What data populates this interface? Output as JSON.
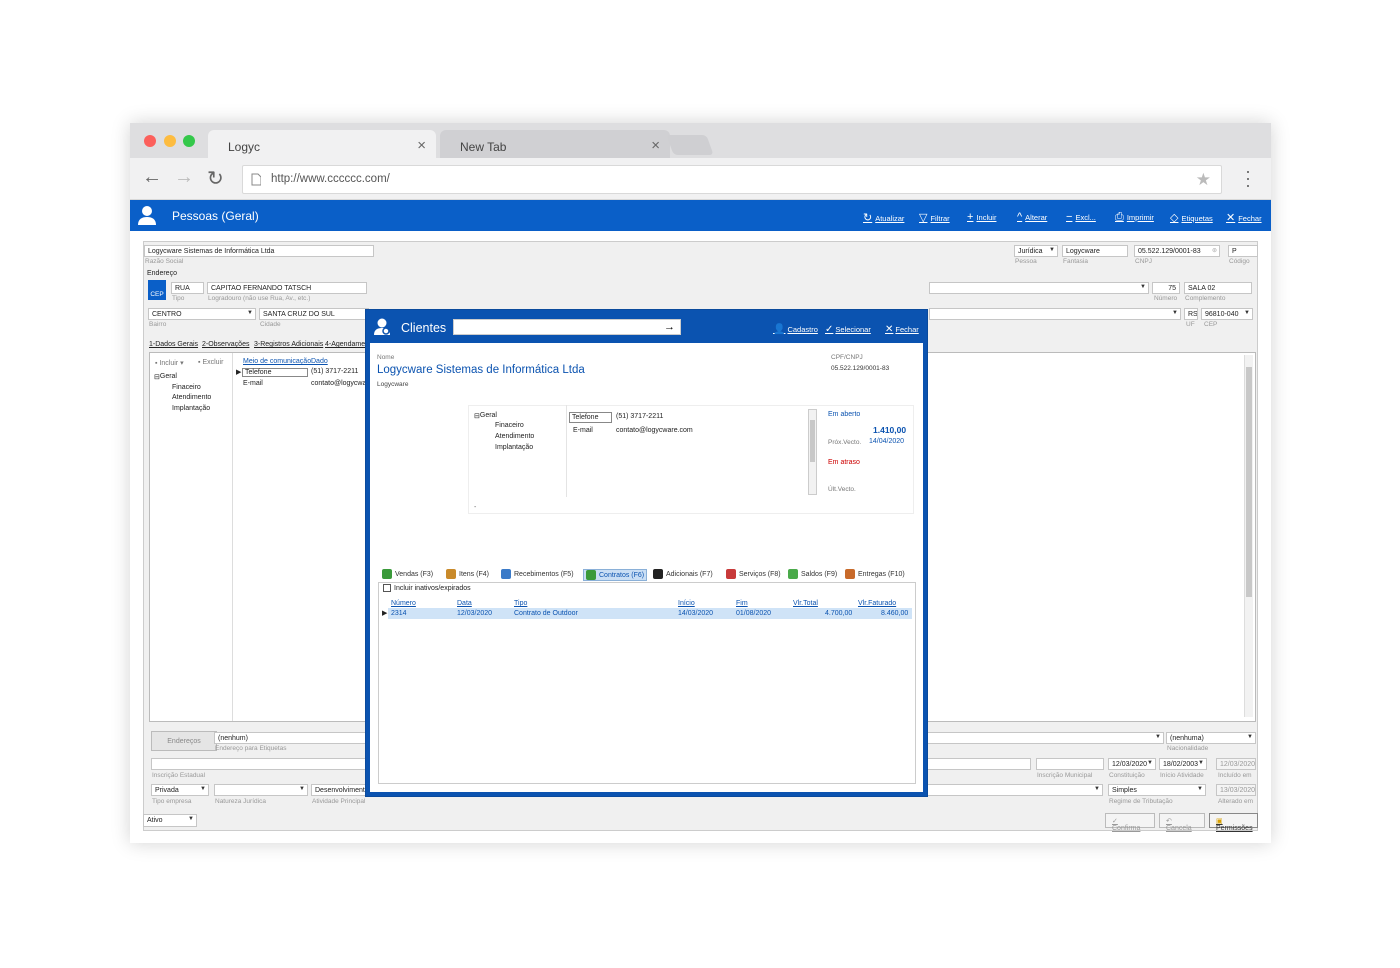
{
  "browser": {
    "tabs": [
      {
        "label": "Logyc"
      },
      {
        "label": "New Tab"
      }
    ],
    "url": "http://www.cccccc.com/"
  },
  "appbar": {
    "title": "Pessoas (Geral)",
    "actions": {
      "atualizar": "Atualizar",
      "filtrar": "Filtrar",
      "incluir": "Incluir",
      "alterar": "Alterar",
      "excluir": "Excl...",
      "imprimir": "Imprimir",
      "etiquetas": "Etiquetas",
      "fechar": "Fechar"
    }
  },
  "form": {
    "razao_social": "Logycware Sistemas de Informática Ltda",
    "razao_social_label": "Razão Social",
    "pessoa": "Jurídica",
    "pessoa_label": "Pessoa",
    "fantasia": "Logycware",
    "fantasia_label": "Fantasia",
    "cnpj": "05.522.129/0001-83",
    "cnpj_label": "CNPJ",
    "codigo": "P",
    "codigo_label": "Código",
    "endereco_label": "Endereço",
    "tipo": "RUA",
    "tipo_label": "Tipo",
    "logradouro": "CAPITAO FERNANDO TATSCH",
    "logradouro_label": "Logradouro (não use Rua, Av., etc.)",
    "numero": "75",
    "numero_label": "Número",
    "complemento": "SALA 02",
    "complemento_label": "Complemento",
    "bairro": "CENTRO",
    "bairro_label": "Bairro",
    "cidade": "SANTA CRUZ DO SUL",
    "cidade_label": "Cidade",
    "uf": "RS",
    "uf_label": "UF",
    "cep": "96810-040",
    "cep_label": "CEP",
    "cep_badge": "CEP",
    "tabs": [
      "1-Dados Gerais",
      "2-Observações",
      "3-Registros Adicionais",
      "4-Agendamen"
    ],
    "incluir": "Incluir",
    "excluir": "Excluir",
    "tree": {
      "root": "Geral",
      "children": [
        "Finaceiro",
        "Atendimento",
        "Implantação"
      ]
    },
    "comm_headers": {
      "meio": "Meio de comunicação",
      "dado": "Dado"
    },
    "comm_rows": [
      {
        "meio": "Telefone",
        "dado": "(51) 3717-2211"
      },
      {
        "meio": "E-mail",
        "dado": "contato@logycwa"
      }
    ],
    "enderecos_btn": "Endereços",
    "endereco_etiquetas": "(nenhum)",
    "endereco_etiquetas_label": "Endereço para Etiquetas",
    "nacionalidade": "(nenhuma)",
    "nacionalidade_label": "Nacionalidade",
    "inscricao_estadual_label": "Inscrição Estadual",
    "inscricao_municipal_label": "Inscrição Municipal",
    "constituicao": "12/03/2020",
    "constituicao_label": "Constituição",
    "inicio_atividade": "18/02/2003",
    "inicio_atividade_label": "Início Atividade",
    "incluido_em": "12/03/2020",
    "incluido_em_label": "Incluído em",
    "tipo_empresa": "Privada",
    "tipo_empresa_label": "Tipo empresa",
    "natureza_juridica_label": "Natureza Jurídica",
    "atividade_principal": "Desenvolvimento",
    "atividade_principal_label": "Atividade Principal",
    "regime": "Simples",
    "regime_label": "Regime de Tributação",
    "alterado_em": "13/03/2020",
    "alterado_em_label": "Alterado em",
    "status": "Ativo",
    "confirma": "Confirma",
    "cancela": "Cancela",
    "permissoes": "Permissões"
  },
  "modal": {
    "title": "Clientes",
    "search_value": "",
    "actions": {
      "cadastro": "Cadastro",
      "selecionar": "Selecionar",
      "fechar": "Fechar"
    },
    "nome_label": "Nome",
    "nome": "Logycware Sistemas de Informática Ltda",
    "fantasia": "Logycware",
    "cpf_label": "CPF/CNPJ",
    "cpf": "05.522.129/0001-83",
    "tree": {
      "root": "Geral",
      "children": [
        "Finaceiro",
        "Atendimento",
        "Implantação"
      ]
    },
    "contacts": [
      {
        "meio": "Telefone",
        "dado": "(51) 3717-2211"
      },
      {
        "meio": "E-mail",
        "dado": "contato@logycware.com"
      }
    ],
    "dash": "-",
    "em_aberto": "Em aberto",
    "valor": "1.410,00",
    "prox_vecto_label": "Próx.Vecto.",
    "prox_vecto": "14/04/2020",
    "em_atraso": "Em atraso",
    "ult_vecto_label": "Últ.Vecto.",
    "tabs": [
      "Vendas (F3)",
      "Itens (F4)",
      "Recebimentos (F5)",
      "Contratos (F6)",
      "Adicionais (F7)",
      "Serviços (F8)",
      "Saldos (F9)",
      "Entregas (F10)"
    ],
    "tab_colors": [
      "#3a9a3a",
      "#c98a2a",
      "#3a7ac8",
      "#3a9a3a",
      "#222222",
      "#c83a3a",
      "#4aaa4a",
      "#c86a2a"
    ],
    "incluir_inativos": "Incluir inativos/expirados",
    "grid_headers": {
      "numero": "Número",
      "data": "Data",
      "tipo": "Tipo",
      "inicio": "Início",
      "fim": "Fim",
      "vlr_total": "Vlr.Total",
      "vlr_faturado": "Vlr.Faturado"
    },
    "grid_rows": [
      {
        "numero": "2314",
        "data": "12/03/2020",
        "tipo": "Contrato de Outdoor",
        "inicio": "14/03/2020",
        "fim": "01/08/2020",
        "vlr_total": "4.700,00",
        "vlr_faturado": "8.460,00"
      }
    ]
  }
}
